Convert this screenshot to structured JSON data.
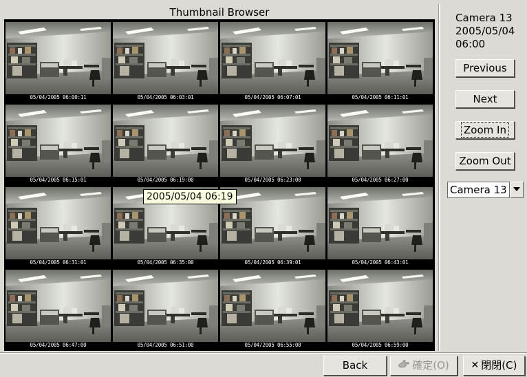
{
  "browser": {
    "title": "Thumbnail Browser",
    "tooltip": "2005/05/04 06:19",
    "thumbnails": [
      "05/04/2005 06:00:11",
      "05/04/2005 06:03:01",
      "05/04/2005 06:07:01",
      "05/04/2005 06:11:01",
      "05/04/2005 06:15:01",
      "05/04/2005 06:19:00",
      "05/04/2005 06:23:00",
      "05/04/2005 06:27:00",
      "05/04/2005 06:31:01",
      "05/04/2005 06:35:00",
      "05/04/2005 06:39:01",
      "05/04/2005 06:43:01",
      "05/04/2005 06:47:00",
      "05/04/2005 06:51:00",
      "05/04/2005 06:55:00",
      "05/04/2005 06:59:00"
    ]
  },
  "side": {
    "camera": "Camera 13",
    "date": "2005/05/04",
    "time": "06:00",
    "previous_label": "Previous",
    "next_label": "Next",
    "zoom_in_label": "Zoom In",
    "zoom_out_label": "Zoom Out",
    "camera_select_value": "Camera 13"
  },
  "footer": {
    "back_label": "Back",
    "ok_label": "確定(O)",
    "close_label": "閉閉(C)"
  },
  "icons": {
    "ok": "hand-point-icon",
    "close": "x-icon",
    "dropdown": "chevron-down-icon"
  },
  "colors": {
    "window_bg": "#dcdad5",
    "tooltip_bg": "#ffffe1",
    "grid_bg": "#000000"
  }
}
